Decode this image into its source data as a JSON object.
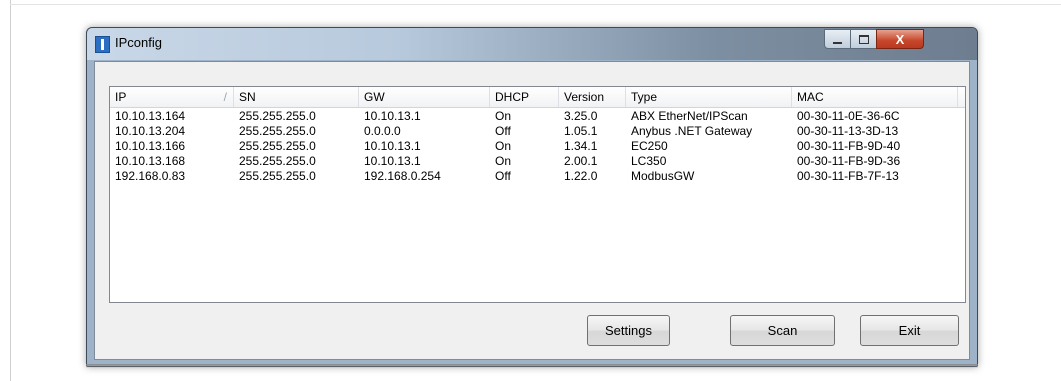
{
  "window": {
    "title": "IPconfig",
    "close_glyph": "X",
    "icons": [
      "app-icon",
      "minimize-icon",
      "maximize-icon",
      "close-icon"
    ]
  },
  "list": {
    "columns": [
      "IP",
      "SN",
      "GW",
      "DHCP",
      "Version",
      "Type",
      "MAC"
    ],
    "sort_indicator": "/",
    "rows": [
      [
        "10.10.13.164",
        "255.255.255.0",
        "10.10.13.1",
        "On",
        "3.25.0",
        "ABX EtherNet/IPScan",
        "00-30-11-0E-36-6C"
      ],
      [
        "10.10.13.204",
        "255.255.255.0",
        "0.0.0.0",
        "Off",
        "1.05.1",
        "Anybus .NET Gateway",
        "00-30-11-13-3D-13"
      ],
      [
        "10.10.13.166",
        "255.255.255.0",
        "10.10.13.1",
        "On",
        "1.34.1",
        "EC250",
        "00-30-11-FB-9D-40"
      ],
      [
        "10.10.13.168",
        "255.255.255.0",
        "10.10.13.1",
        "On",
        "2.00.1",
        "LC350",
        "00-30-11-FB-9D-36"
      ],
      [
        "192.168.0.83",
        "255.255.255.0",
        "192.168.0.254",
        "Off",
        "1.22.0",
        "ModbusGW",
        "00-30-11-FB-7F-13"
      ]
    ]
  },
  "buttons": {
    "settings": "Settings",
    "scan": "Scan",
    "exit": "Exit"
  },
  "colors": {
    "title_bar": "#b7c9dc",
    "close_button": "#c7462a",
    "app_icon": "#2a6fc4"
  }
}
